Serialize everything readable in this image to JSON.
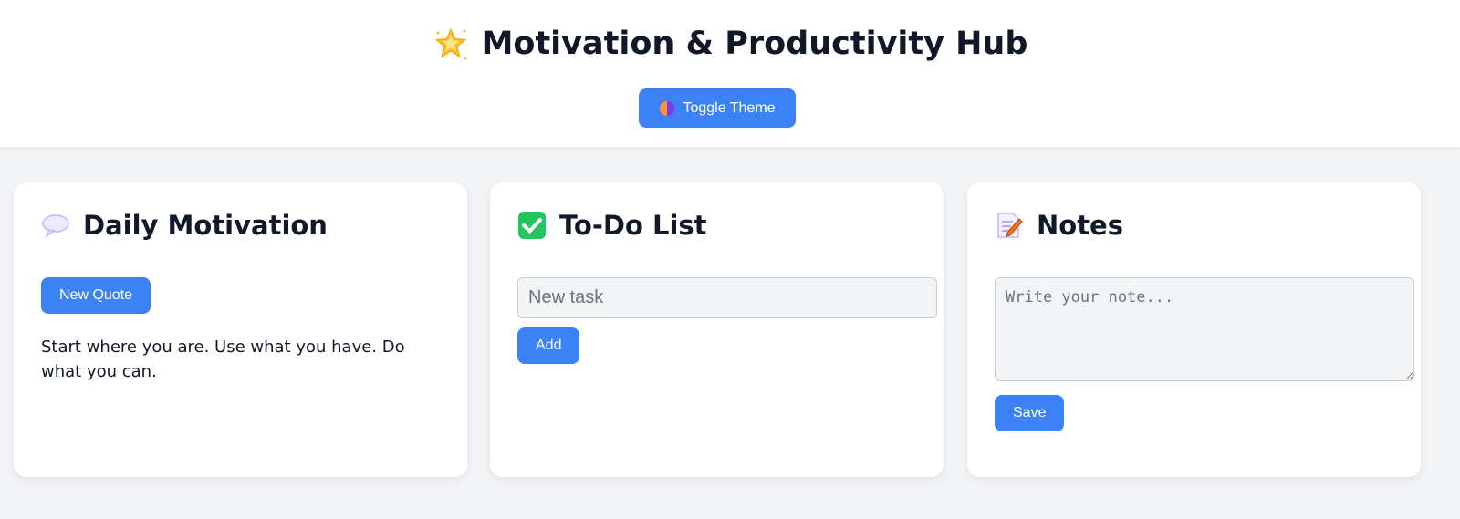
{
  "header": {
    "title": "Motivation & Productivity Hub",
    "title_icon": "glowing-star-icon",
    "theme_button_label": "Toggle Theme",
    "theme_button_icon": "half-moon-theme-icon"
  },
  "cards": {
    "motivation": {
      "title": "Daily Motivation",
      "icon": "speech-balloon-icon",
      "button_label": "New Quote",
      "quote": "Start where you are. Use what you have. Do what you can."
    },
    "todo": {
      "title": "To-Do List",
      "icon": "check-mark-icon",
      "input_placeholder": "New task",
      "input_value": "",
      "button_label": "Add"
    },
    "notes": {
      "title": "Notes",
      "icon": "memo-icon",
      "textarea_placeholder": "Write your note...",
      "textarea_value": "",
      "button_label": "Save"
    }
  },
  "colors": {
    "accent": "#3b82f6",
    "background": "#f3f4f6",
    "card": "#ffffff",
    "text": "#111827"
  }
}
